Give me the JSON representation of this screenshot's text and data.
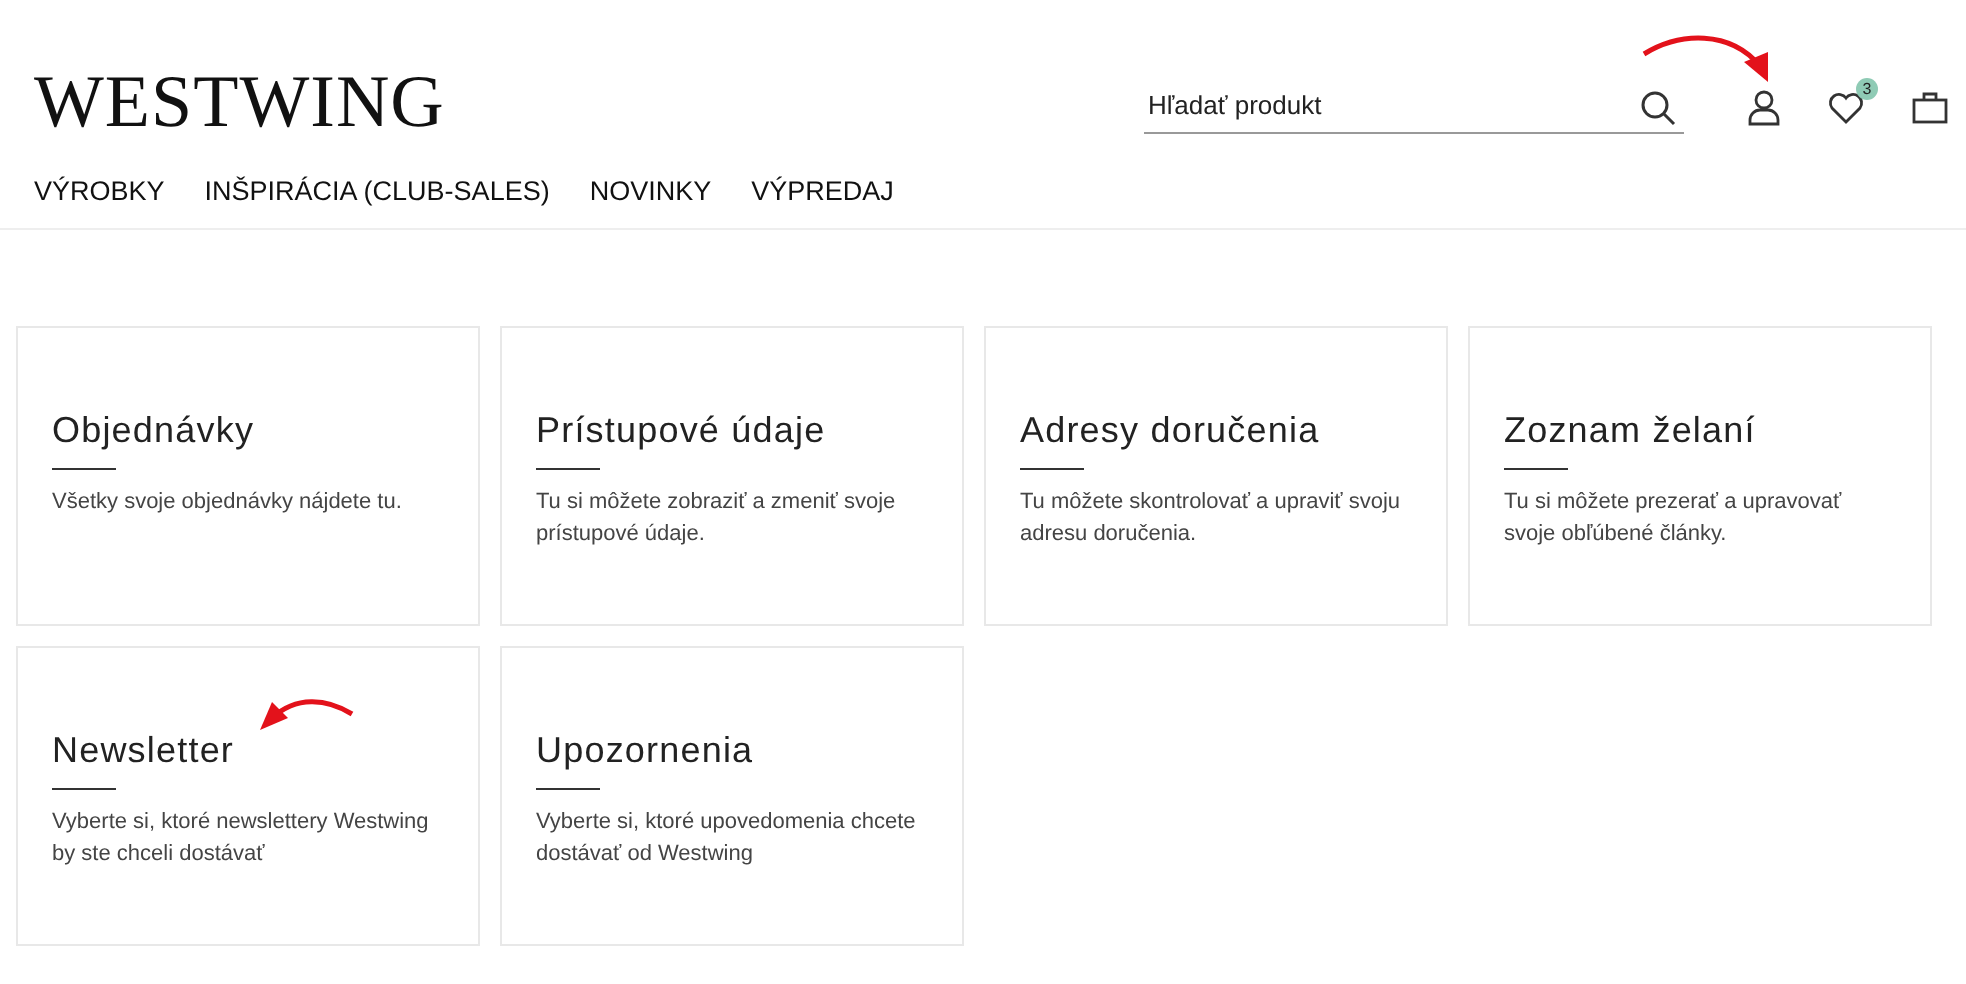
{
  "header": {
    "logo": "WESTWING",
    "search": {
      "placeholder": "Hľadať produkt"
    },
    "wishlist_count": "3"
  },
  "nav": [
    "VÝROBKY",
    "INŠPIRÁCIA (CLUB-SALES)",
    "NOVINKY",
    "VÝPREDAJ"
  ],
  "cards": [
    {
      "title": "Objednávky",
      "description": "Všetky svoje objednávky nájdete tu."
    },
    {
      "title": "Prístupové údaje",
      "description": "Tu si môžete zobraziť a zmeniť svoje prístupové údaje."
    },
    {
      "title": "Adresy doručenia",
      "description": "Tu môžete skontrolovať a upraviť svoju adresu doručenia."
    },
    {
      "title": "Zoznam želaní",
      "description": "Tu si môžete prezerať a upravovať svoje obľúbené články."
    },
    {
      "title": "Newsletter",
      "description": "Vyberte si, ktoré newslettery Westwing by ste chceli dostávať"
    },
    {
      "title": "Upozornenia",
      "description": "Vyberte si, ktoré upovedomenia chcete dostávať od Westwing"
    }
  ]
}
